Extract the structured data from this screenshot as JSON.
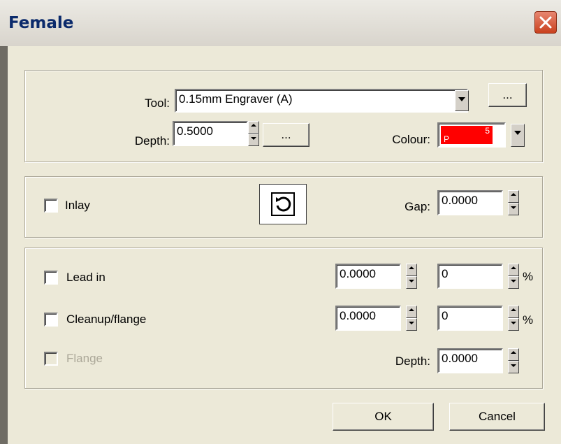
{
  "dialog": {
    "title": "Female",
    "close_icon": "close-icon"
  },
  "tool_group": {
    "tool_label": "Tool:",
    "tool_value": "0.15mm Engraver (A)",
    "tool_browse_label": "...",
    "depth_label": "Depth:",
    "depth_value": "0.5000",
    "depth_browse_label": "...",
    "colour_label": "Colour:",
    "colour_swatch": {
      "color": "#ff0000",
      "letter": "P",
      "number": "5"
    }
  },
  "inlay_group": {
    "inlay_label": "Inlay",
    "inlay_checked": false,
    "reverse_icon": "rotate-ccw-icon",
    "gap_label": "Gap:",
    "gap_value": "0.0000"
  },
  "lead_group": {
    "lead_in_label": "Lead in",
    "lead_in_value": "0.0000",
    "lead_in_percent": "0",
    "cleanup_label": "Cleanup/flange",
    "cleanup_value": "0.0000",
    "cleanup_percent": "0",
    "percent_symbol": "%",
    "flange_label": "Flange",
    "flange_depth_label": "Depth:",
    "flange_depth_value": "0.0000"
  },
  "buttons": {
    "ok": "OK",
    "cancel": "Cancel"
  }
}
